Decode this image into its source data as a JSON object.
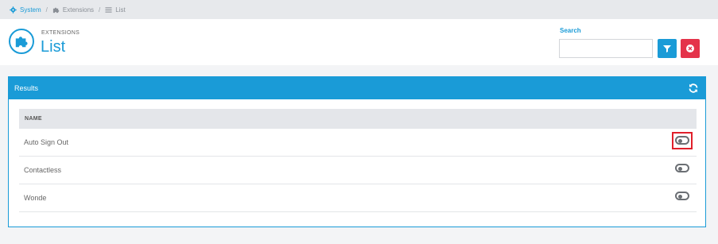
{
  "breadcrumb": {
    "items": [
      {
        "label": "System",
        "icon": "gear-icon"
      },
      {
        "label": "Extensions",
        "icon": "puzzle-icon"
      },
      {
        "label": "List",
        "icon": "list-icon"
      }
    ],
    "separator": "/"
  },
  "header": {
    "subtitle": "EXTENSIONS",
    "title": "List",
    "icon": "puzzle-icon"
  },
  "search": {
    "label": "Search",
    "value": "",
    "placeholder": ""
  },
  "results": {
    "title": "Results",
    "column_header": "NAME",
    "rows": [
      {
        "name": "Auto Sign Out",
        "enabled": false,
        "highlighted": true
      },
      {
        "name": "Contactless",
        "enabled": false,
        "highlighted": false
      },
      {
        "name": "Wonde",
        "enabled": false,
        "highlighted": false
      }
    ]
  },
  "colors": {
    "accent": "#1a9bd7",
    "danger": "#e4334a",
    "highlight": "#e0202b"
  }
}
